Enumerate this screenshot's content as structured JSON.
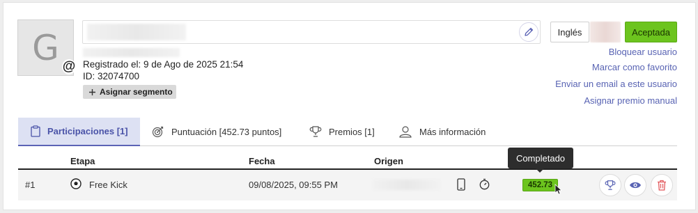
{
  "profile": {
    "avatar_letter": "G",
    "at_symbol": "@",
    "registered": "Registrado el: 9 de Ago de 2025 21:54",
    "id_line": "ID: 32074700",
    "segment_button": "Asignar segmento"
  },
  "header_actions": {
    "language_button": "Inglés",
    "accept_button": "Aceptada"
  },
  "links": {
    "block": "Bloquear usuario",
    "favorite": "Marcar como favorito",
    "email": "Enviar un email a este usuario",
    "prize": "Asignar premio manual"
  },
  "tabs": {
    "participations": "Participaciones [1]",
    "score": "Puntuación [452.73 puntos]",
    "prizes": "Premios [1]",
    "more_info": "Más información"
  },
  "table": {
    "headers": {
      "stage": "Etapa",
      "date": "Fecha",
      "origin": "Origen"
    },
    "rows": [
      {
        "index": "#1",
        "stage": "Free Kick",
        "date": "09/08/2025, 09:55 PM",
        "score": "452.73"
      }
    ]
  },
  "tooltip": "Completado",
  "colors": {
    "accent": "#5863b3",
    "success": "#6cc41e",
    "danger": "#e2585c"
  }
}
